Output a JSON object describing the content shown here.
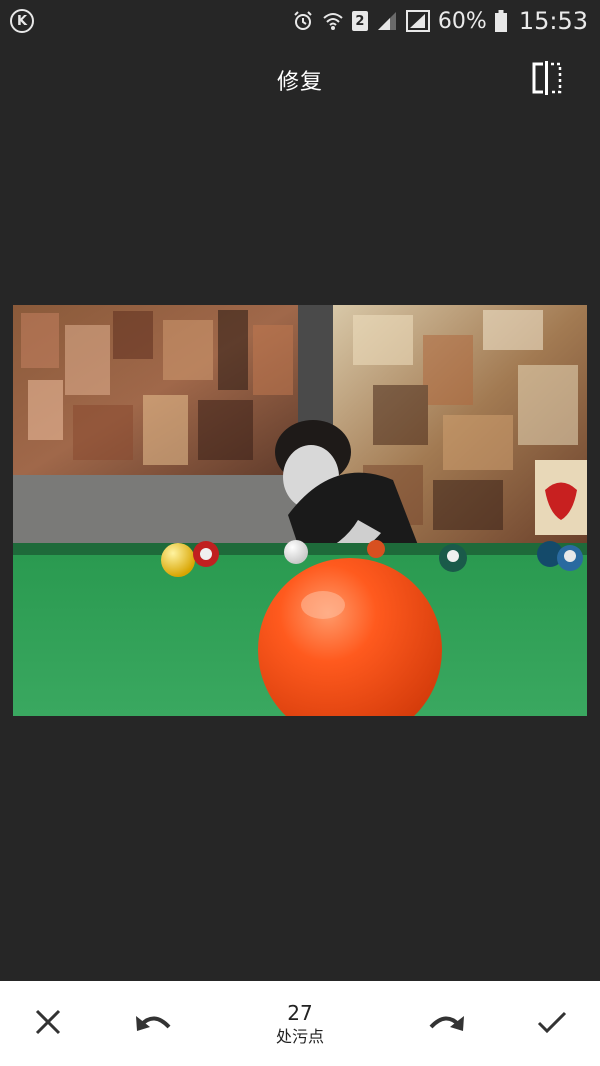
{
  "status_bar": {
    "left_icon": "k-app-icon",
    "icons": [
      "alarm-icon",
      "wifi-icon",
      "sim-2-badge",
      "signal-icon",
      "signal-icon"
    ],
    "sim_label": "2",
    "battery": "60%",
    "time": "15:53"
  },
  "header": {
    "title": "修复",
    "compare_icon": "compare-icon"
  },
  "photo": {
    "subject": "billiards-table-photo"
  },
  "toolbar": {
    "cancel_icon": "close-icon",
    "undo_icon": "undo-icon",
    "count": "27",
    "count_label": "处污点",
    "redo_icon": "redo-icon",
    "apply_icon": "check-icon"
  },
  "colors": {
    "background": "#262626",
    "toolbar_bg": "#ffffff",
    "icon_dark": "#333333"
  }
}
